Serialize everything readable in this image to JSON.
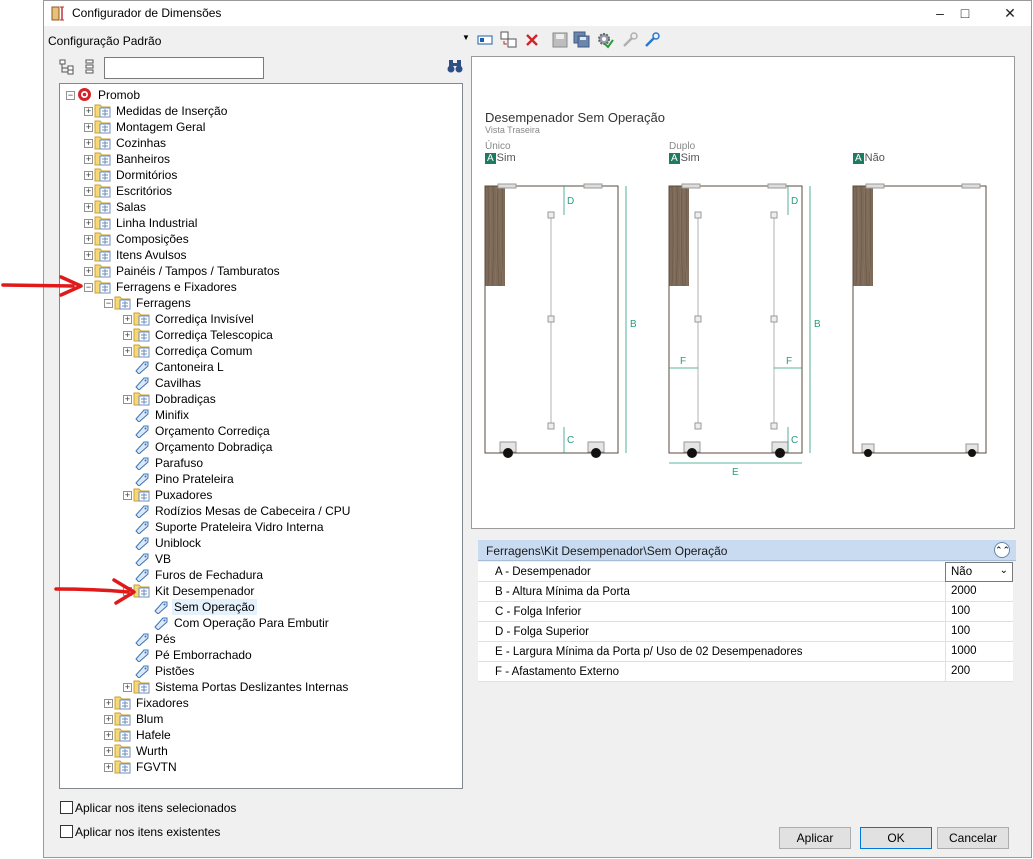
{
  "window": {
    "title": "Configurador de Dimensões",
    "minimize_icon": "minimize-icon",
    "maximize_icon": "maximize-icon",
    "close_icon": "close-icon"
  },
  "config": {
    "selected": "Configuração Padrão"
  },
  "toolbar": {
    "icons": [
      "select-icon",
      "copy-icon",
      "delete-icon",
      "save-icon",
      "save-all-icon",
      "settings-check-icon",
      "tool-grey-icon",
      "tool-blue-icon"
    ]
  },
  "search": {
    "value": "",
    "binoculars_icon": "binoculars-icon"
  },
  "tree": {
    "rows": [
      {
        "label": "Promob"
      },
      {
        "label": "Medidas de Inserção"
      },
      {
        "label": "Montagem Geral"
      },
      {
        "label": "Cozinhas"
      },
      {
        "label": "Banheiros"
      },
      {
        "label": "Dormitórios"
      },
      {
        "label": "Escritórios"
      },
      {
        "label": "Salas"
      },
      {
        "label": "Linha Industrial"
      },
      {
        "label": "Composições"
      },
      {
        "label": "Itens Avulsos"
      },
      {
        "label": "Painéis / Tampos / Tamburatos"
      },
      {
        "label": "Ferragens e Fixadores"
      },
      {
        "label": "Ferragens"
      },
      {
        "label": "Corrediça Invisível"
      },
      {
        "label": "Corrediça Telescopica"
      },
      {
        "label": "Corrediça Comum"
      },
      {
        "label": "Cantoneira L"
      },
      {
        "label": "Cavilhas"
      },
      {
        "label": "Dobradiças"
      },
      {
        "label": "Minifix"
      },
      {
        "label": "Orçamento Corrediça"
      },
      {
        "label": "Orçamento Dobradiça"
      },
      {
        "label": "Parafuso"
      },
      {
        "label": "Pino Prateleira"
      },
      {
        "label": "Puxadores"
      },
      {
        "label": "Rodízios Mesas de Cabeceira / CPU"
      },
      {
        "label": "Suporte Prateleira Vidro Interna"
      },
      {
        "label": "Uniblock"
      },
      {
        "label": "VB"
      },
      {
        "label": "Furos de Fechadura"
      },
      {
        "label": "Kit Desempenador"
      },
      {
        "label": "Sem Operação"
      },
      {
        "label": "Com Operação Para Embutir"
      },
      {
        "label": "Pés"
      },
      {
        "label": "Pé Emborrachado"
      },
      {
        "label": "Pistões"
      },
      {
        "label": "Sistema Portas Deslizantes Internas"
      },
      {
        "label": "Fixadores"
      },
      {
        "label": "Blum"
      },
      {
        "label": "Hafele"
      },
      {
        "label": "Wurth"
      },
      {
        "label": "FGVTN"
      }
    ]
  },
  "options": {
    "apply_selected": "Aplicar nos itens selecionados",
    "apply_existing": "Aplicar nos itens existentes"
  },
  "figure": {
    "title": "Desempenador Sem Operação",
    "subtitle": "Vista Traseira",
    "panels": [
      {
        "heading": "Único",
        "badge": "A",
        "value": "Sim"
      },
      {
        "heading": "Duplo",
        "badge": "A",
        "value": "Sim"
      },
      {
        "heading": "",
        "badge": "A",
        "value": "Não"
      }
    ],
    "dim_labels": {
      "B": "B",
      "C": "C",
      "D": "D",
      "E": "E",
      "F": "F"
    }
  },
  "properties": {
    "path": "Ferragens\\Kit Desempenador\\Sem Operação",
    "rows": [
      {
        "name": "A - Desempenador",
        "value": "Não"
      },
      {
        "name": "B - Altura Mínima da Porta",
        "value": "2000"
      },
      {
        "name": "C - Folga Inferior",
        "value": "100"
      },
      {
        "name": "D - Folga Superior",
        "value": "100"
      },
      {
        "name": "E - Largura Mínima da Porta p/ Uso de 02 Desempenadores",
        "value": "1000"
      },
      {
        "name": "F - Afastamento Externo",
        "value": "200"
      }
    ]
  },
  "buttons": {
    "apply": "Aplicar",
    "ok": "OK",
    "cancel": "Cancelar"
  },
  "colors": {
    "accent": "#0078d7",
    "badge": "#1e7b61",
    "arrow": "#e0191b",
    "wood": "#7d6a58"
  }
}
